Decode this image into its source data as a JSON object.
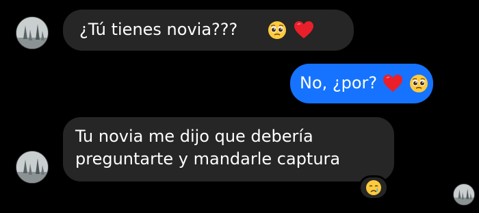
{
  "messages": [
    {
      "direction": "incoming",
      "text": "¿Tú tienes novia???",
      "emojis": [
        "pleading-face",
        "red-heart"
      ],
      "bubble_color": "#262626"
    },
    {
      "direction": "outgoing",
      "text": "No, ¿por?",
      "emojis": [
        "red-heart",
        "pleading-face"
      ],
      "bubble_color": "#1573ff"
    },
    {
      "direction": "incoming",
      "lines": [
        "Tu novia me dijo que debería",
        "preguntarte y mandarle captura"
      ],
      "bubble_color": "#262626",
      "reaction": "crying-face"
    }
  ],
  "colors": {
    "background": "#000000",
    "incoming_bubble": "#262626",
    "outgoing_bubble": "#1573ff",
    "text": "#ffffff"
  }
}
